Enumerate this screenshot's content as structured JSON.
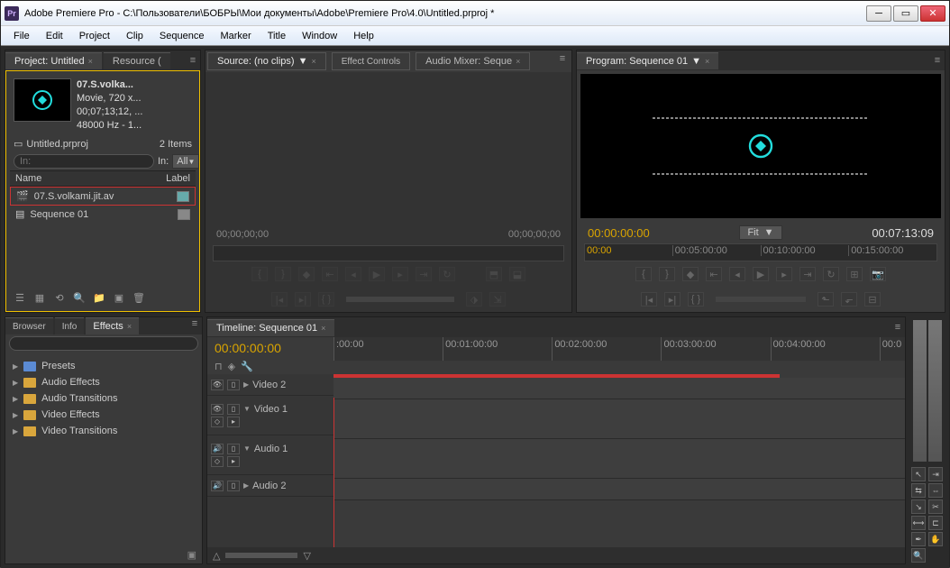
{
  "window": {
    "title": "Adobe Premiere Pro - C:\\Пользователи\\БОБРЫ\\Мои документы\\Adobe\\Premiere Pro\\4.0\\Untitled.prproj *"
  },
  "menu": [
    "File",
    "Edit",
    "Project",
    "Clip",
    "Sequence",
    "Marker",
    "Title",
    "Window",
    "Help"
  ],
  "project": {
    "tab_label": "Project: Untitled",
    "resource_tab": "Resource (",
    "clip": {
      "name": "07.S.volka...",
      "type": "Movie, 720 x...",
      "tc": "00;07;13;12, ...",
      "audio": "48000 Hz - 1..."
    },
    "file_label": "Untitled.prproj",
    "item_count": "2 Items",
    "in_label": "In:",
    "in_value": "All",
    "col_name": "Name",
    "col_label": "Label",
    "items": [
      {
        "name": "07.S.volkami.jit.av",
        "highlight": true
      },
      {
        "name": "Sequence 01",
        "highlight": false
      }
    ]
  },
  "source": {
    "tab": "Source: (no clips)",
    "fx_tab": "Effect Controls",
    "mixer_tab": "Audio Mixer: Seque",
    "tc_left": "00;00;00;00",
    "tc_right": "00;00;00;00"
  },
  "program": {
    "tab": "Program: Sequence 01",
    "tc_left": "00:00:00:00",
    "fit_label": "Fit",
    "tc_right": "00:07:13:09",
    "ruler": [
      "00:00",
      "00:05:00:00",
      "00:10:00:00",
      "00:15:00:00"
    ]
  },
  "browser_tabs": [
    "Browser",
    "Info",
    "Effects"
  ],
  "effects": {
    "items": [
      "Presets",
      "Audio Effects",
      "Audio Transitions",
      "Video Effects",
      "Video Transitions"
    ]
  },
  "timeline": {
    "tab": "Timeline: Sequence 01",
    "tc": "00:00:00:00",
    "ruler": [
      ":00:00",
      "00:01:00:00",
      "00:02:00:00",
      "00:03:00:00",
      "00:04:00:00",
      "00:0"
    ],
    "tracks": [
      {
        "label": "Video 2",
        "kind": "v",
        "expanded": false
      },
      {
        "label": "Video 1",
        "kind": "v",
        "expanded": true
      },
      {
        "label": "Audio 1",
        "kind": "a",
        "expanded": true
      },
      {
        "label": "Audio 2",
        "kind": "a",
        "expanded": false
      }
    ]
  }
}
